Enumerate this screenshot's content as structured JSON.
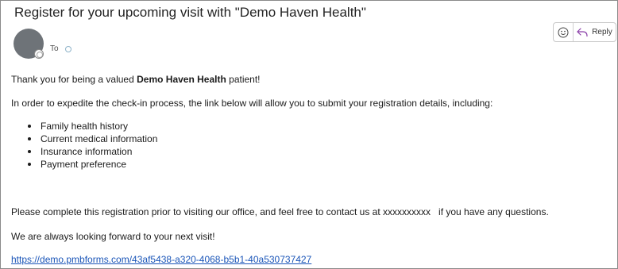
{
  "email": {
    "subject": "Register for your upcoming visit with \"Demo Haven Health\"",
    "to_label": "To",
    "reply_label": "Reply"
  },
  "body": {
    "greeting_prefix": "Thank you for being a valued ",
    "greeting_bold": "Demo Haven Health",
    "greeting_suffix": " patient!",
    "intro": "In order to expedite the check-in process, the link below will allow you to submit your registration details, including:",
    "items": [
      "Family health history",
      "Current medical information",
      "Insurance information",
      "Payment preference"
    ],
    "complete": "Please complete this registration prior to visiting our office, and feel free to contact us at xxxxxxxxxx   if you have any questions.",
    "closing": "We are always looking forward to your next visit!",
    "link": "https://demo.pmbforms.com/43af5438-a320-4068-b5b1-40a530737427"
  },
  "icons": {
    "emoji": "smiley-icon",
    "reply": "reply-arrow-icon"
  },
  "colors": {
    "link": "#1a55b8",
    "reply_arrow": "#8a3fa8",
    "avatar": "#6e7378"
  }
}
